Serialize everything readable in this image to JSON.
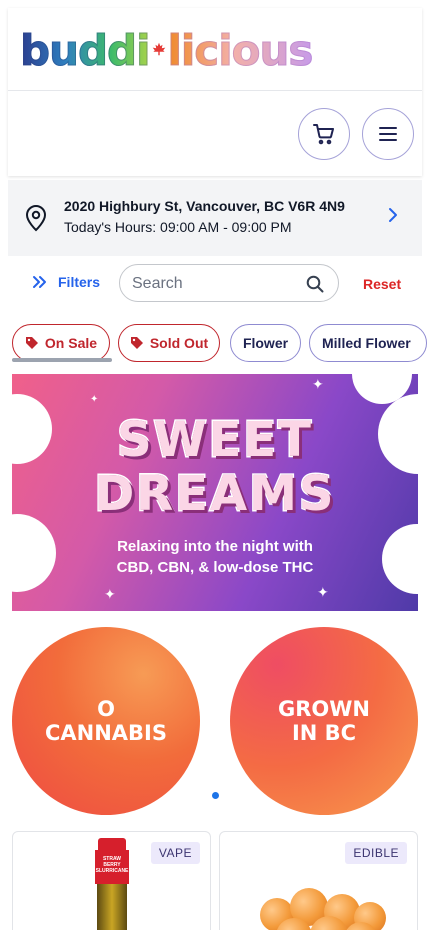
{
  "brand": {
    "name_part1": "buddi",
    "name_separator": "•",
    "name_part2": "licious"
  },
  "header": {
    "cart_icon": "shopping-cart-icon",
    "menu_icon": "hamburger-menu-icon"
  },
  "store": {
    "address": "2020 Highbury St, Vancouver, BC V6R 4N9",
    "hours": "Today's Hours: 09:00 AM - 09:00 PM"
  },
  "filters": {
    "filters_label": "Filters",
    "search_placeholder": "Search",
    "search_value": "",
    "reset_label": "Reset"
  },
  "chips": [
    {
      "label": "On Sale",
      "icon": "tag-icon"
    },
    {
      "label": "Sold Out",
      "icon": "tag-icon"
    },
    {
      "label": "Flower"
    },
    {
      "label": "Milled Flower"
    }
  ],
  "banner": {
    "title_line1": "SWEET",
    "title_line2": "DREAMS",
    "subtitle_line1": "Relaxing into the night with",
    "subtitle_line2": "CBD, CBN, & low-dose THC"
  },
  "categories": [
    {
      "line1": "O",
      "line2": "CANNABIS"
    },
    {
      "line1": "GROWN",
      "line2": "IN BC"
    }
  ],
  "products": [
    {
      "badge": "VAPE",
      "product_label": "STRAW BERRY SLURRICANE"
    },
    {
      "badge": "EDIBLE"
    }
  ],
  "colors": {
    "accent_blue": "#2563eb",
    "sale_red": "#c0262d",
    "chip_border": "#8f8bd1",
    "reset_red": "#dc2626"
  }
}
